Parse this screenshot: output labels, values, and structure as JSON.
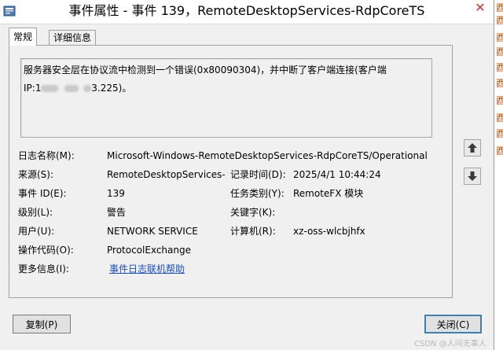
{
  "window": {
    "title": "事件属性 - 事件 139，RemoteDesktopServices-RdpCoreTS",
    "close_glyph": "✕"
  },
  "tabs": [
    {
      "label": "常规",
      "selected": true
    },
    {
      "label": "详细信息",
      "selected": false
    }
  ],
  "description": {
    "line1": "服务器安全层在协议流中检测到一个错误(0x80090304)，并中断了客户端连接(客户端",
    "line2_prefix": "IP:1",
    "line2_suffix": "3.225)。"
  },
  "fields": {
    "log_name": {
      "label": "日志名称(M):",
      "value": "Microsoft-Windows-RemoteDesktopServices-RdpCoreTS/Operational"
    },
    "source": {
      "label": "来源(S):",
      "value": "RemoteDesktopServices-R"
    },
    "logged": {
      "label": "记录时间(D):",
      "value": "2025/4/1 10:44:24"
    },
    "event_id": {
      "label": "事件 ID(E):",
      "value": "139"
    },
    "task_category": {
      "label": "任务类别(Y):",
      "value": "RemoteFX 模块"
    },
    "level": {
      "label": "级别(L):",
      "value": "警告"
    },
    "keywords": {
      "label": "关键字(K):",
      "value": ""
    },
    "user": {
      "label": "用户(U):",
      "value": "NETWORK SERVICE"
    },
    "computer": {
      "label": "计算机(R):",
      "value": "xz-oss-wlcbjhfx"
    },
    "opcode": {
      "label": "操作代码(O):",
      "value": "ProtocolExchange"
    },
    "more_info": {
      "label": "更多信息(I):",
      "link": "事件日志联机帮助"
    }
  },
  "buttons": {
    "copy": "复制(P)",
    "close": "关闭(C)"
  },
  "background_char": "酉",
  "watermark": "CSDN @人间无事人",
  "colors": {
    "link": "#1a4fc4",
    "close_x": "#d32f2f",
    "panel_bg": "#f0f0f0"
  }
}
